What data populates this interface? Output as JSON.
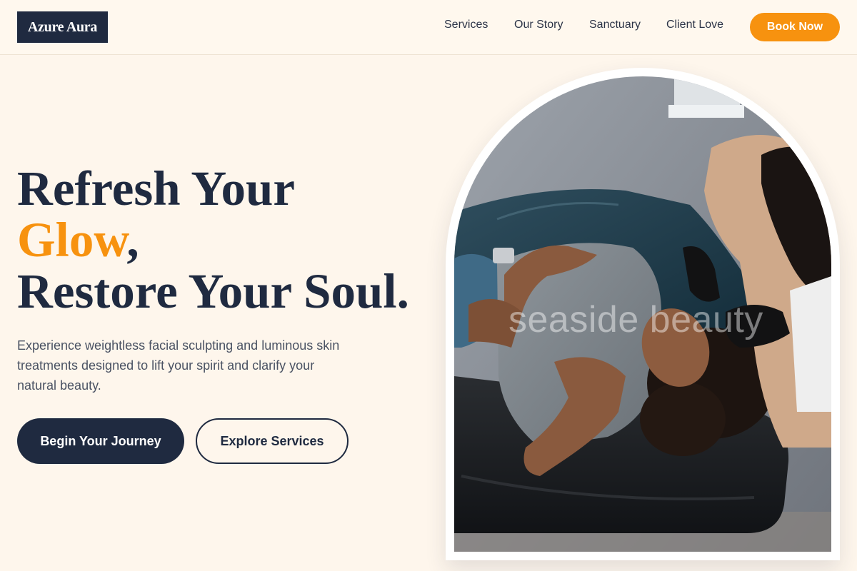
{
  "header": {
    "logo": "Azure Aura",
    "nav": [
      {
        "label": "Services"
      },
      {
        "label": "Our Story"
      },
      {
        "label": "Sanctuary"
      },
      {
        "label": "Client Love"
      }
    ],
    "cta": "Book Now"
  },
  "hero": {
    "title_line1": "Refresh Your",
    "title_accent": "Glow",
    "title_comma": ",",
    "title_line3": "Restore Your Soul.",
    "subtitle": "Experience weightless facial sculpting and luminous skin treatments designed to lift your spirit and clarify your natural beauty.",
    "primary_button": "Begin Your Journey",
    "secondary_button": "Explore Services"
  },
  "image": {
    "watermark": "seaside beauty",
    "icon": "facial-treatment-photo"
  },
  "colors": {
    "background": "#fef6ec",
    "navy": "#1f2a40",
    "accent": "#f7920f"
  }
}
